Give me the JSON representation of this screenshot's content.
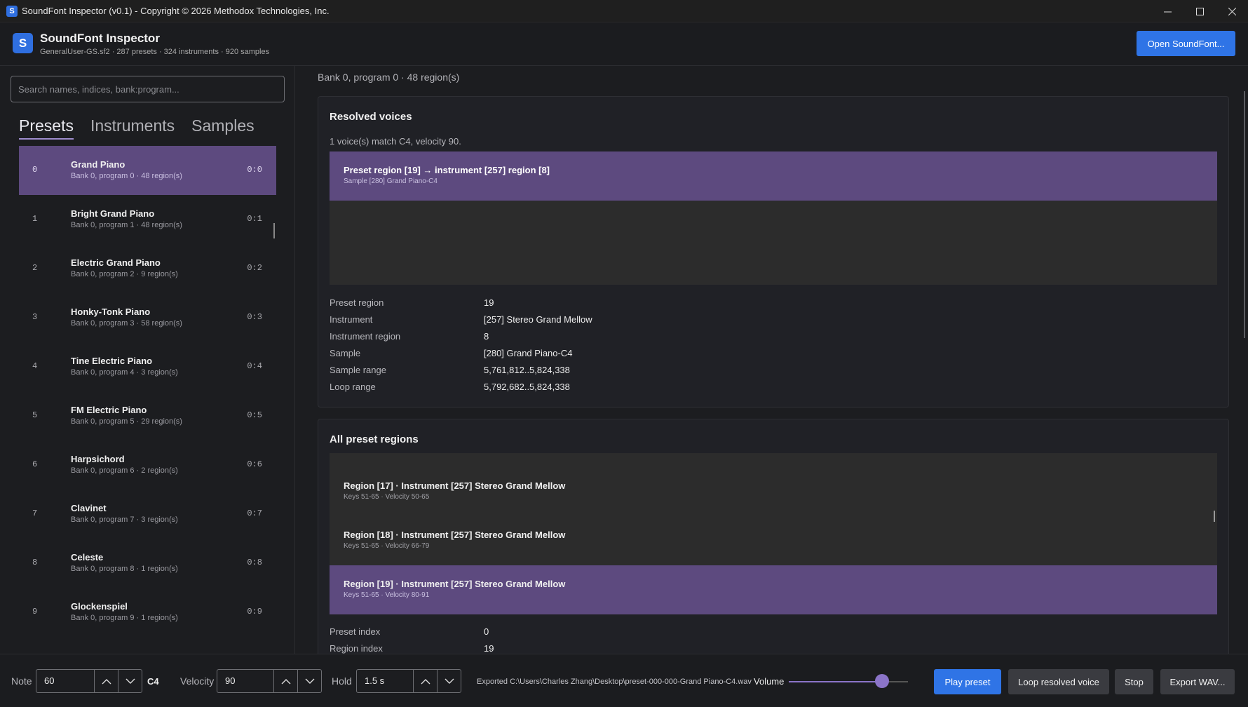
{
  "window": {
    "title": "SoundFont Inspector (v0.1) - Copyright © 2026 Methodox Technologies, Inc.",
    "icon_letter": "S"
  },
  "header": {
    "logo_letter": "S",
    "app_name": "SoundFont Inspector",
    "subtitle": "GeneralUser-GS.sf2 · 287 presets · 324 instruments · 920 samples",
    "open_button": "Open SoundFont..."
  },
  "sidebar": {
    "search_placeholder": "Search names, indices, bank:program...",
    "tabs": [
      {
        "label": "Presets",
        "active": true
      },
      {
        "label": "Instruments",
        "active": false
      },
      {
        "label": "Samples",
        "active": false
      }
    ],
    "items": [
      {
        "index": "0",
        "name": "Grand Piano",
        "meta": "Bank 0, program 0 · 48 region(s)",
        "bank_program": "0:0",
        "selected": true
      },
      {
        "index": "1",
        "name": "Bright Grand Piano",
        "meta": "Bank 0, program 1 · 48 region(s)",
        "bank_program": "0:1"
      },
      {
        "index": "2",
        "name": "Electric Grand Piano",
        "meta": "Bank 0, program 2 · 9 region(s)",
        "bank_program": "0:2"
      },
      {
        "index": "3",
        "name": "Honky-Tonk Piano",
        "meta": "Bank 0, program 3 · 58 region(s)",
        "bank_program": "0:3"
      },
      {
        "index": "4",
        "name": "Tine Electric Piano",
        "meta": "Bank 0, program 4 · 3 region(s)",
        "bank_program": "0:4"
      },
      {
        "index": "5",
        "name": "FM Electric Piano",
        "meta": "Bank 0, program 5 · 29 region(s)",
        "bank_program": "0:5"
      },
      {
        "index": "6",
        "name": "Harpsichord",
        "meta": "Bank 0, program 6 · 2 region(s)",
        "bank_program": "0:6"
      },
      {
        "index": "7",
        "name": "Clavinet",
        "meta": "Bank 0, program 7 · 3 region(s)",
        "bank_program": "0:7"
      },
      {
        "index": "8",
        "name": "Celeste",
        "meta": "Bank 0, program 8 · 1 region(s)",
        "bank_program": "0:8"
      },
      {
        "index": "9",
        "name": "Glockenspiel",
        "meta": "Bank 0, program 9 · 1 region(s)",
        "bank_program": "0:9"
      }
    ]
  },
  "main": {
    "breadcrumb": "Bank 0, program 0 · 48 region(s)",
    "resolved": {
      "title": "Resolved voices",
      "note": "1 voice(s) match C4, velocity 90.",
      "voice_title": "Preset region [19] → instrument [257] region [8]",
      "voice_sub": "Sample [280] Grand Piano-C4",
      "details": [
        {
          "key": "Preset region",
          "value": "19"
        },
        {
          "key": "Instrument",
          "value": "[257] Stereo Grand Mellow"
        },
        {
          "key": "Instrument region",
          "value": "8"
        },
        {
          "key": "Sample",
          "value": "[280] Grand Piano-C4"
        },
        {
          "key": "Sample range",
          "value": "5,761,812..5,824,338"
        },
        {
          "key": "Loop range",
          "value": "5,792,682..5,824,338"
        }
      ]
    },
    "regions": {
      "title": "All preset regions",
      "items": [
        {
          "title": "Region [17] · Instrument [257] Stereo Grand Mellow",
          "sub": "Keys 51-65 · Velocity 50-65"
        },
        {
          "title": "Region [18] · Instrument [257] Stereo Grand Mellow",
          "sub": "Keys 51-65 · Velocity 66-79"
        },
        {
          "title": "Region [19] · Instrument [257] Stereo Grand Mellow",
          "sub": "Keys 51-65 · Velocity 80-91",
          "selected": true
        }
      ],
      "details": [
        {
          "key": "Preset index",
          "value": "0"
        },
        {
          "key": "Region index",
          "value": "19"
        }
      ]
    }
  },
  "controls": {
    "note_label": "Note",
    "note_value": "60",
    "note_name": "C4",
    "velocity_label": "Velocity",
    "velocity_value": "90",
    "hold_label": "Hold",
    "hold_value": "1.5 s",
    "export_status": "Exported C:\\Users\\Charles Zhang\\Desktop\\preset-000-000-Grand Piano-C4.wav",
    "volume_label": "Volume",
    "volume_level": 0.78,
    "buttons": {
      "play": "Play preset",
      "loop": "Loop resolved voice",
      "stop": "Stop",
      "export": "Export WAV..."
    }
  },
  "colors": {
    "accent": "#2f74e6",
    "selection": "#5d4a7f",
    "slider": "#8b74c8"
  }
}
